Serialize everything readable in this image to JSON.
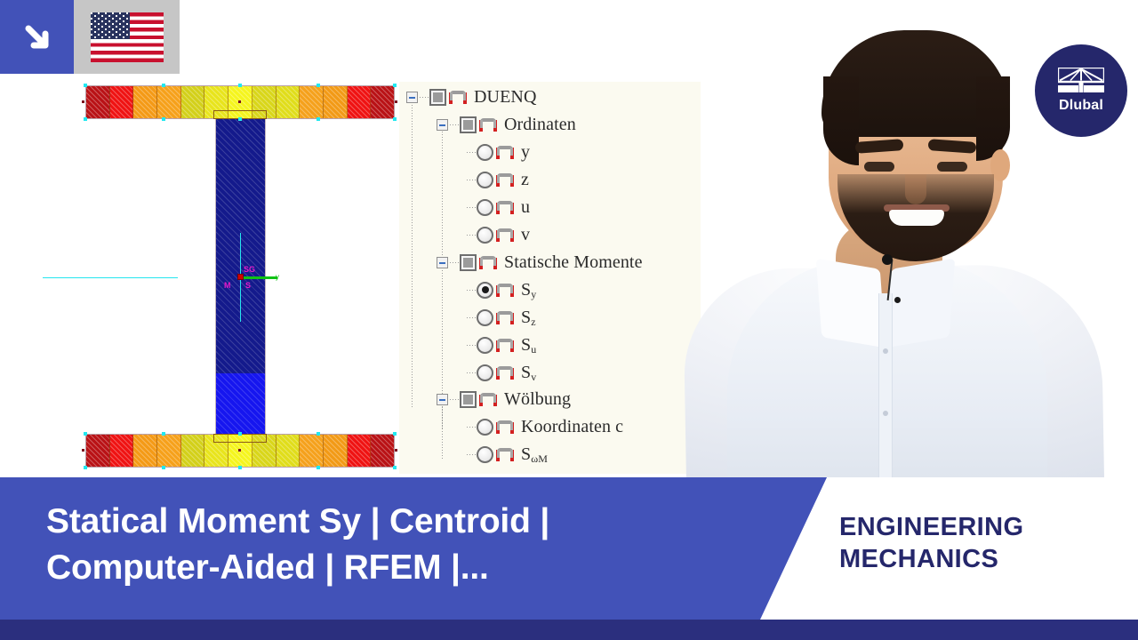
{
  "overlay": {
    "arrow_icon": "arrow-down-right-icon",
    "flag_icon": "us-flag-icon",
    "flag_label": "United States"
  },
  "logo": {
    "name": "Dlubal",
    "mark_icon": "truss-frame-icon"
  },
  "cad": {
    "caption": "cross-section-statical-moment-plot",
    "centroid_labels": {
      "sg": "SG",
      "m": "M",
      "s": "S",
      "y_axis": "y"
    },
    "top_flange_colors": [
      "#b91216",
      "#ef1313",
      "#f49a16",
      "#f6a11b",
      "#d3d01a",
      "#e8e41c",
      "#f5f51e",
      "#d9d61a",
      "#e0dd1b",
      "#f5a11c",
      "#f29a16",
      "#ef1313",
      "#b91216"
    ],
    "bottom_flange_colors": [
      "#b91216",
      "#ef1313",
      "#f49a16",
      "#f6a11b",
      "#d3d01a",
      "#e8e41c",
      "#f5f51e",
      "#d9d61a",
      "#e0dd1b",
      "#f5a11c",
      "#f29a16",
      "#ef1313",
      "#b91216"
    ],
    "web_top_color": "#141a8c",
    "web_bottom_color": "#1616ef"
  },
  "tree": {
    "root": {
      "label": "DUENQ",
      "expanded": true
    },
    "groups": [
      {
        "label": "Ordinaten",
        "expanded": true,
        "items": [
          {
            "label": "y",
            "selected": false
          },
          {
            "label": "z",
            "selected": false
          },
          {
            "label": "u",
            "selected": false
          },
          {
            "label": "v",
            "selected": false
          }
        ]
      },
      {
        "label": "Statische Momente",
        "expanded": true,
        "items": [
          {
            "label": "S",
            "sub": "y",
            "selected": true
          },
          {
            "label": "S",
            "sub": "z",
            "selected": false
          },
          {
            "label": "S",
            "sub": "u",
            "selected": false
          },
          {
            "label": "S",
            "sub": "v",
            "selected": false
          }
        ]
      },
      {
        "label": "Wölbung",
        "expanded": true,
        "items": [
          {
            "label": "Koordinaten c",
            "selected": false
          },
          {
            "label": "S",
            "sub": "ωM",
            "selected": false
          }
        ]
      }
    ]
  },
  "banner": {
    "title_line1": "Statical Moment Sy | Centroid |",
    "title_line2": "Computer-Aided | RFEM |...",
    "category_line1": "ENGINEERING",
    "category_line2": "MECHANICS",
    "accent_color": "#4252b8",
    "category_color": "#25276b",
    "foot_color": "#2b2f7e"
  }
}
